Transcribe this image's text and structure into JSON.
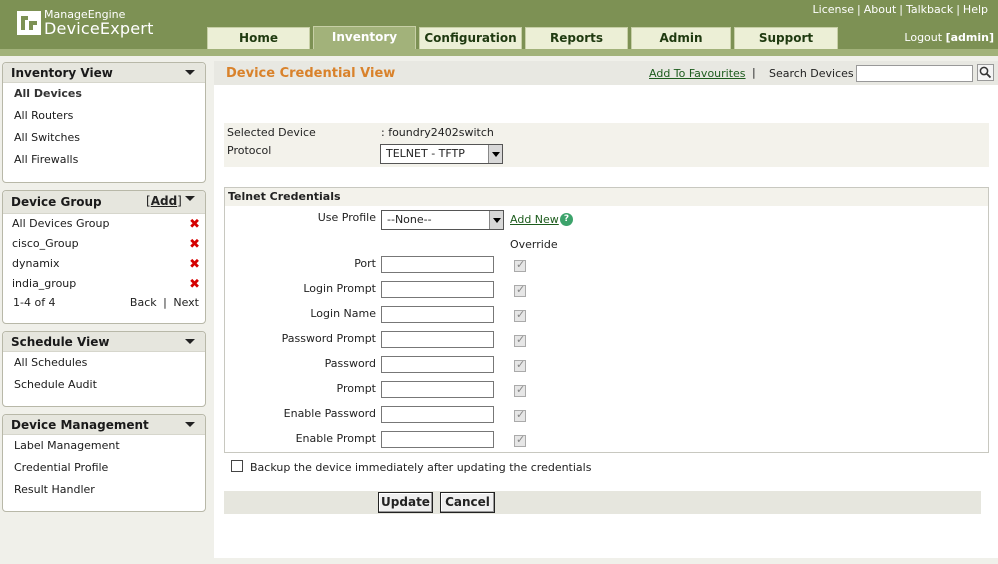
{
  "header": {
    "logo_small": "ManageEngine",
    "logo_big": "DeviceExpert",
    "top_links": [
      "License",
      "About",
      "Talkback",
      "Help"
    ],
    "logout_label": "Logout",
    "logout_user": "[admin]"
  },
  "tabs": [
    {
      "label": "Home",
      "active": false
    },
    {
      "label": "Inventory",
      "active": true
    },
    {
      "label": "Configuration",
      "active": false
    },
    {
      "label": "Reports",
      "active": false
    },
    {
      "label": "Admin",
      "active": false
    },
    {
      "label": "Support",
      "active": false
    }
  ],
  "sidebar": {
    "inventory": {
      "title": "Inventory View",
      "items": [
        "All Devices",
        "All Routers",
        "All Switches",
        "All Firewalls"
      ]
    },
    "device_group": {
      "title": "Device Group",
      "add_label": "Add",
      "items": [
        "All Devices Group",
        "cisco_Group",
        "dynamix",
        "india_group"
      ],
      "pager_text": "1-4 of 4",
      "back_label": "Back",
      "next_label": "Next"
    },
    "schedule": {
      "title": "Schedule View",
      "items": [
        "All Schedules",
        "Schedule Audit"
      ]
    },
    "device_mgmt": {
      "title": "Device Management",
      "items": [
        "Label Management",
        "Credential Profile",
        "Result Handler"
      ]
    }
  },
  "main": {
    "title": "Device Credential View",
    "fav_link": "Add To Favourites",
    "fav_sep": "|",
    "search_label": "Search Devices",
    "search_value": "",
    "selected_device_label": "Selected Device",
    "selected_device_value": ": foundry2402switch",
    "protocol_label": "Protocol",
    "protocol_value": "TELNET - TFTP",
    "cred_title": "Telnet Credentials",
    "use_profile_label": "Use Profile",
    "use_profile_value": "--None--",
    "add_new_label": "Add New",
    "help_glyph": "?",
    "override_label": "Override",
    "fields": [
      "Port",
      "Login Prompt",
      "Login Name",
      "Password Prompt",
      "Password",
      "Prompt",
      "Enable Password",
      "Enable Prompt"
    ],
    "backup_label": "Backup the device immediately after updating the credentials",
    "update_label": "Update",
    "cancel_label": "Cancel"
  },
  "colors": {
    "header_green": "#7d9154",
    "accent_orange": "#d9822b",
    "link_green": "#1d5c1d",
    "delete_red": "#d40000"
  }
}
